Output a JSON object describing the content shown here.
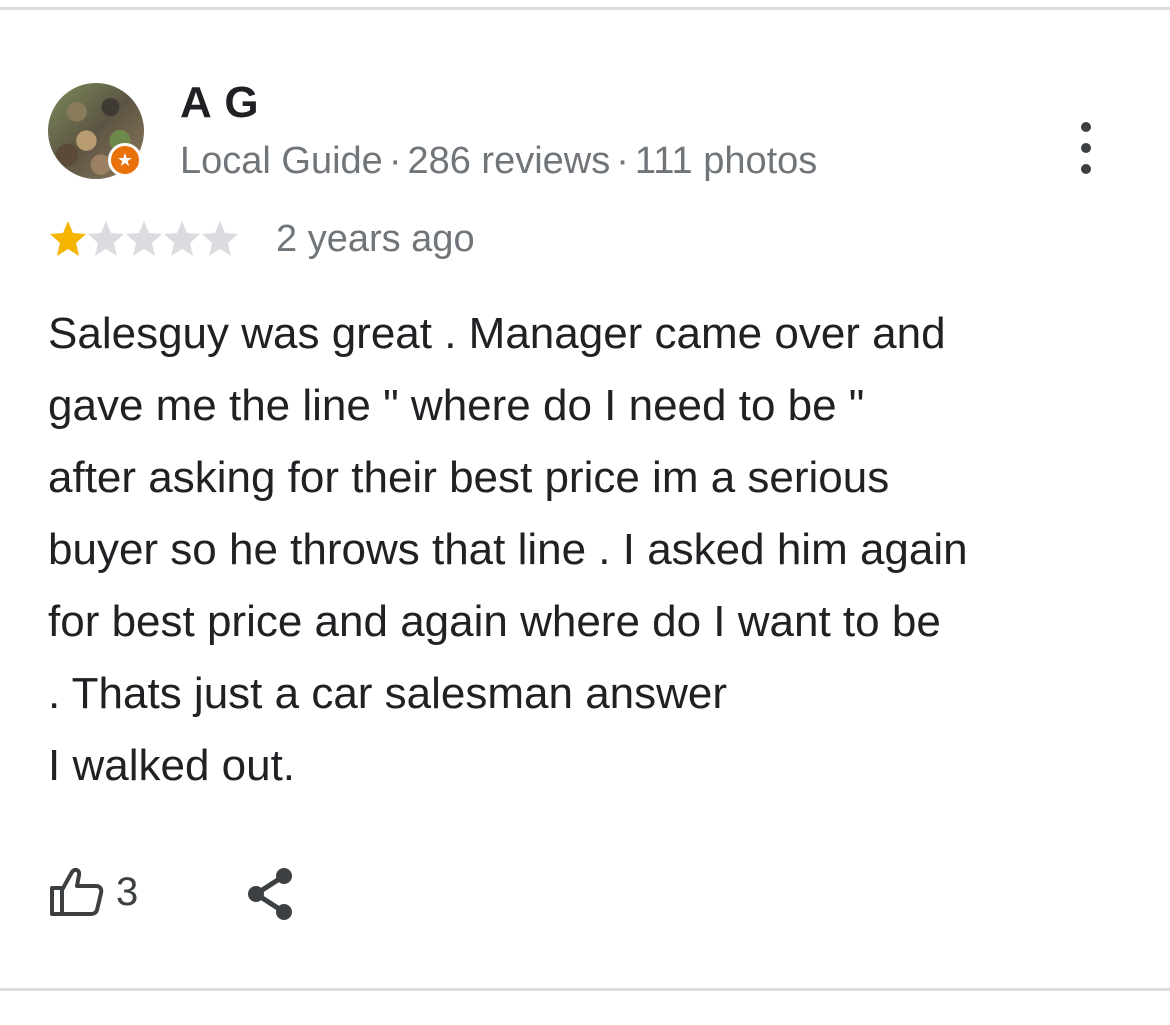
{
  "review": {
    "reviewer": {
      "name": "A G",
      "badge_icon": "local-guide-star-icon",
      "level": "Local Guide",
      "separator": "·",
      "review_count": "286 reviews",
      "photo_count": "111 photos"
    },
    "rating": 1,
    "rating_max": 5,
    "time": "2 years ago",
    "text_lines": [
      "Salesguy was great . Manager came over and",
      "gave me the line \" where do I need to be \"",
      "after asking for their best price im a serious",
      "buyer so he throws that line . I asked him again",
      "for best price and again where do I want to be",
      ". Thats just a car salesman answer",
      "I walked out."
    ],
    "likes": "3",
    "icons": {
      "more": "more-vert-icon",
      "like": "thumb-up-icon",
      "share": "share-icon"
    }
  },
  "colors": {
    "star_filled": "#f4b400",
    "star_empty": "#dadce0",
    "badge": "#e8710a",
    "secondary_text": "#70757a",
    "divider": "#dadce0"
  }
}
